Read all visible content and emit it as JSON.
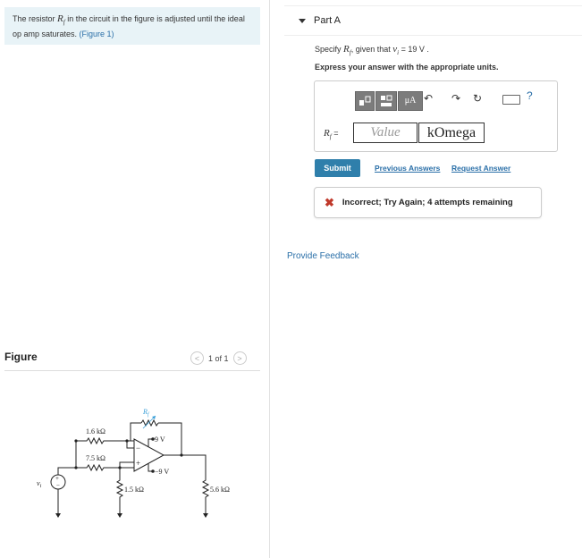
{
  "problem": {
    "text_before": "The resistor ",
    "var": "R",
    "var_sub": "f",
    "text_after": " in the circuit in the figure is adjusted until the ideal op amp saturates. ",
    "figure_link": "(Figure 1)"
  },
  "figure": {
    "label": "Figure",
    "pager": "1 of 1",
    "prev": "<",
    "next": ">",
    "circuit": {
      "r1": "1.6 kΩ",
      "r2": "7.5 kΩ",
      "r3": "1.5 kΩ",
      "r4": "5.6 kΩ",
      "rf": "R",
      "rf_sub": "f",
      "vpos": "9 V",
      "vneg": "−9 V",
      "source": "v",
      "source_sub": "i",
      "plus": "+",
      "minus": "−"
    }
  },
  "part": {
    "title": "Part A",
    "specify_prefix": "Specify ",
    "var": "R",
    "var_sub": "f",
    "specify_mid": ", given that ",
    "given_var": "v",
    "given_sub": "i",
    "given_value": " = 19 V .",
    "express": "Express your answer with the appropriate units.",
    "input_label_var": "R",
    "input_label_sub": "f",
    "input_label_eq": " =",
    "value_placeholder": "Value",
    "unit": "kOmega",
    "toolbar": {
      "mu": "μA",
      "help": "?"
    },
    "submit": "Submit",
    "previous_answers": "Previous Answers",
    "request_answer": "Request Answer",
    "feedback": "Incorrect; Try Again; 4 attempts remaining",
    "feedback_color": "#c0392b"
  },
  "provide_feedback": "Provide Feedback",
  "colors": {
    "accent": "#2f7fab",
    "link": "#2a6fa8",
    "problem_bg": "#e8f3f7",
    "rf_blue": "#3a9fd8"
  }
}
